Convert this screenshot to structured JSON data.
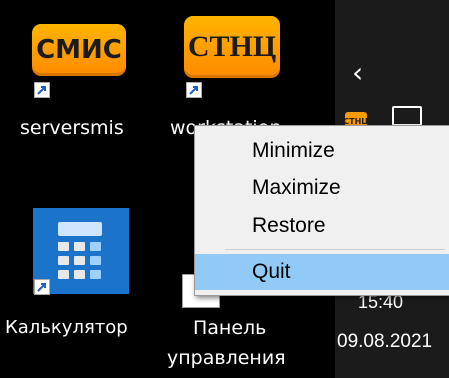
{
  "desktop": {
    "icons": [
      {
        "label": "serversmis",
        "tile_text": "СМИС",
        "tile_color": "#ff9f00"
      },
      {
        "label": "workstation",
        "tile_text": "СТНЦ",
        "tile_color": "#ff9f00"
      },
      {
        "label": "Калькулятор"
      },
      {
        "label_line1": "Панель",
        "label_line2": "управления"
      }
    ]
  },
  "taskbar": {
    "tray_app_text": "СТНЦ",
    "time": "15:40",
    "date": "09.08.2021"
  },
  "context_menu": {
    "items": [
      {
        "label": "Minimize",
        "highlighted": false
      },
      {
        "label": "Maximize",
        "highlighted": false
      },
      {
        "label": "Restore",
        "highlighted": false
      },
      {
        "label": "Quit",
        "highlighted": true
      }
    ],
    "highlight_color": "#91c9f7"
  }
}
